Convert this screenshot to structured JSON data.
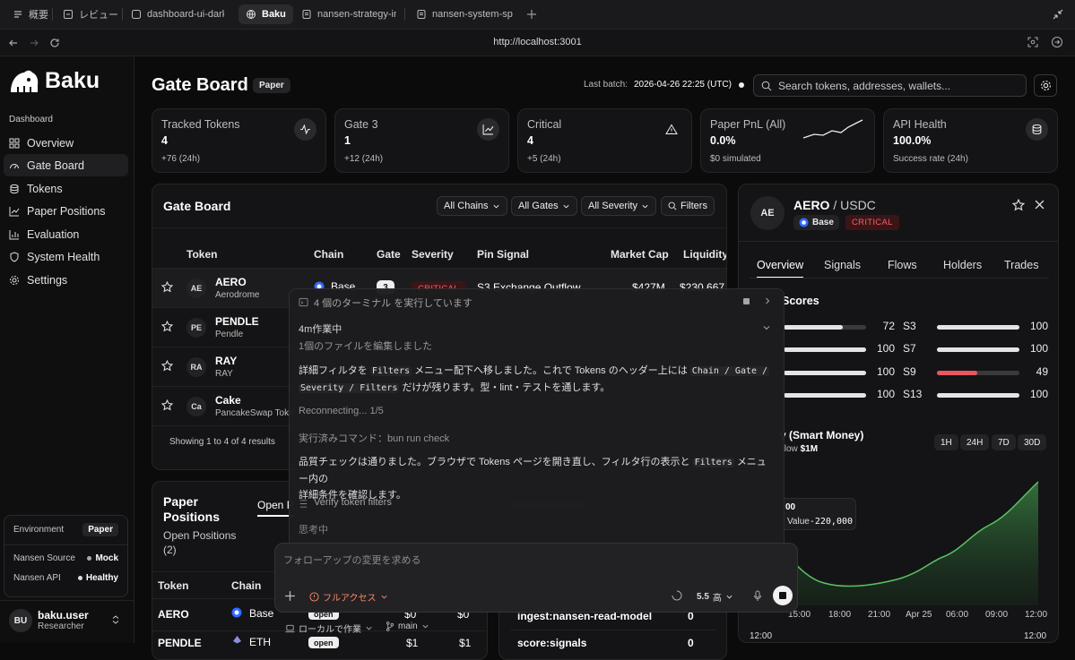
{
  "tabs": [
    "概要",
    "レビュー",
    "dashboard-ui-dark",
    "Baku",
    "nansen-strategy-im",
    "nansen-system-spe"
  ],
  "url": "http://localhost:3001",
  "brand": "Baku",
  "sidebar": {
    "section": "Dashboard",
    "items": [
      "Overview",
      "Gate Board",
      "Tokens",
      "Paper Positions",
      "Evaluation",
      "System Health",
      "Settings"
    ],
    "env": {
      "environment_label": "Environment",
      "environment_value": "Paper",
      "source_label": "Nansen Source",
      "source_value": "Mock",
      "api_label": "Nansen API",
      "api_value": "Healthy"
    },
    "user": {
      "initials": "BU",
      "name": "baku.user",
      "role": "Researcher"
    }
  },
  "header": {
    "title": "Gate Board",
    "badge": "Paper",
    "last_batch_label": "Last batch:",
    "last_batch_value": "2026-04-26 22:25 (UTC)",
    "search_placeholder": "Search tokens, addresses, wallets..."
  },
  "stats": [
    {
      "title": "Tracked Tokens",
      "value": "4",
      "sub": "+76 (24h)"
    },
    {
      "title": "Gate 3",
      "value": "1",
      "sub": "+12 (24h)"
    },
    {
      "title": "Critical",
      "value": "4",
      "sub": "+5 (24h)"
    },
    {
      "title": "Paper PnL (All)",
      "value": "0.0%",
      "sub": "$0 simulated"
    },
    {
      "title": "API Health",
      "value": "100.0%",
      "sub": "Success rate (24h)"
    }
  ],
  "board": {
    "title": "Gate Board",
    "filters": [
      "All Chains",
      "All Gates",
      "All Severity",
      "Filters"
    ],
    "columns": [
      "Token",
      "Chain",
      "Gate",
      "Severity",
      "Pin Signal",
      "Market Cap",
      "Liquidity"
    ],
    "rows": [
      {
        "abbr": "AE",
        "name": "AERO",
        "full": "Aerodrome",
        "chain": "Base",
        "gate": "3",
        "severity": "CRITICAL",
        "signal": "S3 Exchange Outflow",
        "mcap": "$427M",
        "liq": "$230,667"
      },
      {
        "abbr": "PE",
        "name": "PENDLE",
        "full": "Pendle"
      },
      {
        "abbr": "RA",
        "name": "RAY",
        "full": "RAY"
      },
      {
        "abbr": "Ca",
        "name": "Cake",
        "full": "PancakeSwap Toke"
      }
    ],
    "footer": "Showing 1 to 4 of 4 results"
  },
  "positions": {
    "title": "Paper Positions",
    "sub": "Open Positions (2)",
    "tab": "Open P",
    "columns": [
      "Token",
      "Chain"
    ],
    "rows": [
      {
        "token": "AERO",
        "chain": "Base",
        "status": "open",
        "v1": "$0",
        "v2": "$0"
      },
      {
        "token": "PENDLE",
        "chain": "ETH",
        "status": "open",
        "v1": "$1",
        "v2": "$1"
      }
    ]
  },
  "health_rows": [
    {
      "name": "ingest:nansen-read-model",
      "value": "0"
    },
    {
      "name": "score:signals",
      "value": "0"
    }
  ],
  "detail": {
    "avatar": "AE",
    "pair_base": "AERO",
    "pair_quote": "/ USDC",
    "chain": "Base",
    "severity": "CRITICAL",
    "tabs": [
      "Overview",
      "Signals",
      "Flows",
      "Holders",
      "Trades"
    ],
    "scores_title": "Scores",
    "scores_left": [
      {
        "value": 72,
        "label": "S3"
      },
      {
        "value": 100,
        "label": "S7"
      },
      {
        "value": 100,
        "label": "S9"
      },
      {
        "value": 100,
        "label": "S13"
      }
    ],
    "scores_right": [
      {
        "value": 100
      },
      {
        "value": 100
      },
      {
        "value": 49
      },
      {
        "value": 100
      }
    ],
    "flow_title": "y (Smart Money)",
    "flow_sub_label": "flow",
    "flow_sub_value": "$1M",
    "timeframes": [
      "1H",
      "24H",
      "7D",
      "30D"
    ],
    "tooltip_top": "00",
    "tooltip_label": "Value",
    "tooltip_value": "-220,000",
    "xticks": [
      "15:00",
      "18:00",
      "21:00",
      "Apr 25",
      "06:00",
      "09:00",
      "12:00"
    ],
    "xticks2": [
      "12:00",
      "12:00"
    ]
  },
  "overlay": {
    "header": "4 個のターミナル を実行しています",
    "working": "4m作業中",
    "edited": "1個のファイルを編集しました",
    "msg1_a": "詳細フィルタを",
    "msg1_code1": "Filters",
    "msg1_b": "メニュー配下へ移しました。これで Tokens のヘッダー上には",
    "msg1_code2": "Chain / Gate /",
    "msg1_code3": "Severity / Filters",
    "msg1_c": "だけが残ります。型・lint・テストを通します。",
    "reconnecting": "Reconnecting... 1/5",
    "cmd": "実行済みコマンド：bun run check",
    "msg2_a": "品質チェックは通りました。ブラウザで Tokens ページを開き直し、フィルタ行の表示と",
    "msg2_code": "Filters",
    "msg2_b": "メニュー内の",
    "msg2_c": "詳細条件を確認します。",
    "verify": "Verify token filters",
    "thinking": "思考中",
    "placeholder": "フォローアップの変更を求める",
    "access": "フルアクセス",
    "model": "5.5",
    "level": "高",
    "local": "ローカルで作業",
    "branch": "main"
  },
  "colors": {
    "accent_green": "#4caf50",
    "critical": "#ff5b64",
    "bg": "#0b0b0c"
  }
}
